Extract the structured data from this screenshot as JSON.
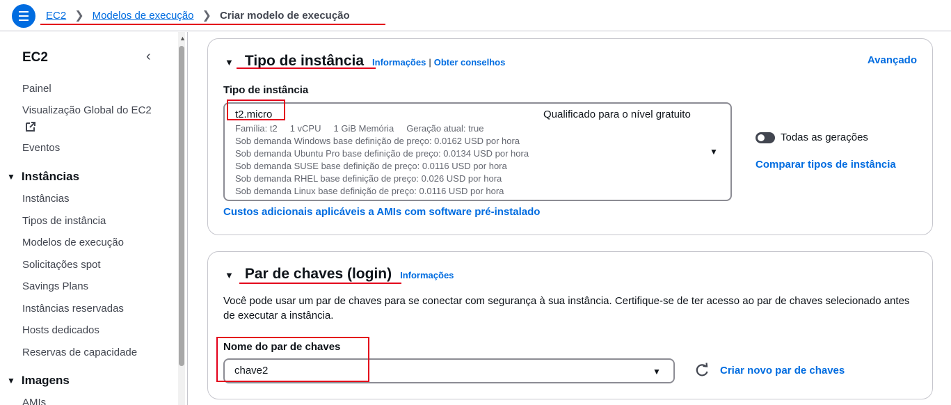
{
  "breadcrumb": {
    "items": [
      "EC2",
      "Modelos de execução"
    ],
    "current": "Criar modelo de execução"
  },
  "sidebar": {
    "title": "EC2",
    "top_items": [
      "Painel",
      "Visualização Global do EC2",
      "Eventos"
    ],
    "sections": [
      {
        "label": "Instâncias",
        "items": [
          "Instâncias",
          "Tipos de instância",
          "Modelos de execução",
          "Solicitações spot",
          "Savings Plans",
          "Instâncias reservadas",
          "Hosts dedicados",
          "Reservas de capacidade"
        ]
      },
      {
        "label": "Imagens",
        "items": [
          "AMIs"
        ]
      }
    ]
  },
  "instance_panel": {
    "title": "Tipo de instância",
    "info": "Informações",
    "advice": "Obter conselhos",
    "advanced": "Avançado",
    "field_label": "Tipo de instância",
    "selected": "t2.micro",
    "free_tier": "Qualificado para o nível gratuito",
    "meta": [
      "Família: t2",
      "1 vCPU",
      "1 GiB Memória",
      "Geração atual: true"
    ],
    "pricing": [
      "Sob demanda Windows base definição de preço: 0.0162 USD por hora",
      "Sob demanda Ubuntu Pro base definição de preço: 0.0134 USD por hora",
      "Sob demanda SUSE base definição de preço: 0.0116 USD por hora",
      "Sob demanda RHEL base definição de preço: 0.026 USD por hora",
      "Sob demanda Linux base definição de preço: 0.0116 USD por hora"
    ],
    "all_generations": "Todas as gerações",
    "all_generations_on": false,
    "compare": "Comparar tipos de instância",
    "extra_costs": "Custos adicionais aplicáveis a AMIs com software pré-instalado"
  },
  "keypair_panel": {
    "title": "Par de chaves (login)",
    "info": "Informações",
    "description": "Você pode usar um par de chaves para se conectar com segurança à sua instância. Certifique-se de ter acesso ao par de chaves selecionado antes de executar a instância.",
    "field_label": "Nome do par de chaves",
    "selected": "chave2",
    "create": "Criar novo par de chaves"
  },
  "colors": {
    "link": "#006ce0",
    "annotation": "#e3001b"
  }
}
